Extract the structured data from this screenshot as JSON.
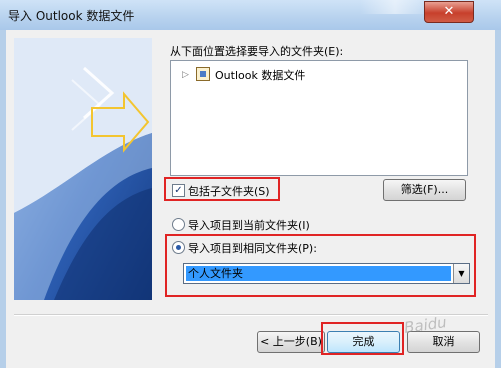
{
  "window": {
    "title": "导入 Outlook 数据文件",
    "close_glyph": "✕"
  },
  "folder_prompt": "从下面位置选择要导入的文件夹(E):",
  "tree": {
    "items": [
      {
        "label": "Outlook 数据文件"
      }
    ]
  },
  "include_subfolders": {
    "label": "包括子文件夹(S)",
    "checked": true
  },
  "filter_button": "筛选(F)...",
  "import_options": [
    {
      "label": "导入项目到当前文件夹(I)",
      "selected": false
    },
    {
      "label": "导入项目到相同文件夹(P):",
      "selected": true
    }
  ],
  "target_folder": {
    "value": "个人文件夹"
  },
  "buttons": {
    "back": "< 上一步(B)",
    "finish": "完成",
    "cancel": "取消"
  },
  "colors": {
    "highlight_box": "#e02424",
    "selection": "#3399ff",
    "titlebar": "#b9d3ef"
  }
}
